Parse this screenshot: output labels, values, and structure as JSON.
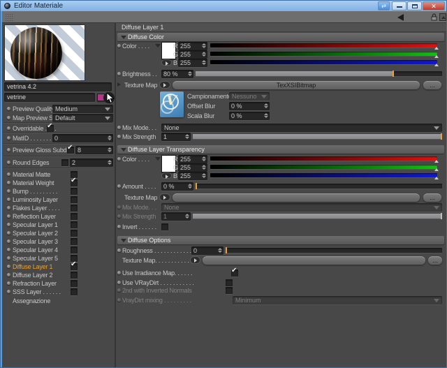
{
  "window": {
    "title": "Editor Materiale"
  },
  "colors": {
    "accent_orange": "#E8A23C",
    "swatch_magenta": "#B5348C",
    "vray_blue": "#4E8FC6",
    "close_red": "#C0392B"
  },
  "sidebar": {
    "material_name": "vetrina 4.2",
    "shader_name": "vetrine",
    "preview_quality": {
      "label": "Preview Quality",
      "value": "Medium"
    },
    "map_preview_size": {
      "label": "Map Preview Size",
      "value": "Default"
    },
    "overridable": {
      "label": "Overridable . . . .",
      "checked": true
    },
    "matid": {
      "label": "MatID . . . . . . . . .",
      "value": "0"
    },
    "preview_gloss_subdivs": {
      "label": "Preview Gloss Subdivs",
      "checked": true,
      "value": "8"
    },
    "round_edges": {
      "label": "Round Edges",
      "checked": false,
      "value": "2"
    },
    "layers": [
      {
        "label": "Material Matte",
        "checked": false
      },
      {
        "label": "Material Weight",
        "checked": true
      },
      {
        "label": "Bump . . . . . . . . .",
        "checked": false
      },
      {
        "label": "Luminosity Layer",
        "checked": false
      },
      {
        "label": "Flakes Layer . . . .",
        "checked": false
      },
      {
        "label": "Reflection Layer",
        "checked": false
      },
      {
        "label": "Specular Layer 1",
        "checked": false
      },
      {
        "label": "Specular Layer 2",
        "checked": false
      },
      {
        "label": "Specular Layer 3",
        "checked": false
      },
      {
        "label": "Specular Layer 4",
        "checked": false
      },
      {
        "label": "Specular Layer 5",
        "checked": false
      },
      {
        "label": "Diffuse Layer 1",
        "checked": true,
        "active": true
      },
      {
        "label": "Diffuse Layer 2",
        "checked": false
      },
      {
        "label": "Refraction Layer",
        "checked": false
      },
      {
        "label": "SSS Layer . . . . . .",
        "checked": false
      }
    ],
    "assegnazione_label": "Assegnazione"
  },
  "panel": {
    "header": "Diffuse Layer 1",
    "diffuse_color": {
      "title": "Diffuse Color",
      "color_label": "Color . . . . ",
      "rgb": [
        {
          "channel": "R",
          "value": "255"
        },
        {
          "channel": "G",
          "value": "255"
        },
        {
          "channel": "B",
          "value": "255"
        }
      ],
      "brightness": {
        "label": "Brightness . .",
        "value": "80 %",
        "percent": 80
      },
      "texture_map": {
        "label": "Texture Map",
        "value": "TexXSIBitmap",
        "more": "..."
      },
      "campionamento": {
        "label": "Campionamento",
        "value": "Nessuno"
      },
      "offset_blur": {
        "label": "Offset Blur",
        "value": "0 %"
      },
      "scala_blur": {
        "label": "Scala Blur",
        "value": "0 %"
      },
      "mix_mode": {
        "label": "Mix Mode. . .",
        "value": "None"
      },
      "mix_strength": {
        "label": "Mix Strength",
        "value": "1",
        "percent": 100
      }
    },
    "transparency": {
      "title": "Diffuse Layer Transparency",
      "color_label": "Color . . . . ",
      "rgb": [
        {
          "channel": "R",
          "value": "255"
        },
        {
          "channel": "G",
          "value": "255"
        },
        {
          "channel": "B",
          "value": "255"
        }
      ],
      "amount": {
        "label": "Amount . . . .",
        "value": "0 %",
        "percent": 0
      },
      "texture_map": {
        "label": "Texture Map",
        "more": "..."
      },
      "mix_mode": {
        "label": "Mix Mode. . .",
        "value": "None",
        "disabled": true
      },
      "mix_strength": {
        "label": "Mix Strength",
        "value": "1",
        "percent": 100,
        "disabled": true
      },
      "invert": {
        "label": "Invert . . . . . .",
        "checked": false
      }
    },
    "options": {
      "title": "Diffuse Options",
      "roughness": {
        "label": "Roughness . . . . . . . . . . . . .",
        "value": "0",
        "percent": 0
      },
      "texture_map": {
        "label": "Texture Map. . . . . . . . . . . . .",
        "more": "..."
      },
      "use_irradiance_map": {
        "label": "Use Irradiance Map. . . . . .",
        "checked": true
      },
      "use_vraydirt": {
        "label": "Use VRayDirt . . . . . . . . . . .",
        "checked": false
      },
      "second_inverted_normals": {
        "label": "2nd with Inverted Normals",
        "checked": false,
        "disabled": true
      },
      "vraydirt_mixing": {
        "label": "VrayDirt mixing . . . . . . . . .",
        "value": "Minimum",
        "disabled": true
      }
    }
  }
}
